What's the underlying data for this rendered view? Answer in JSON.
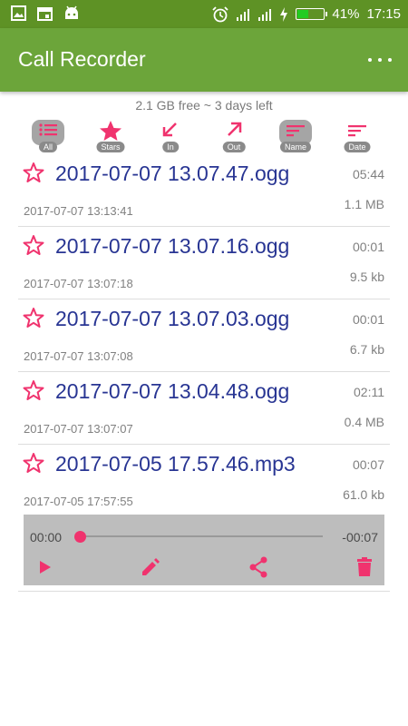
{
  "status_bar": {
    "battery_percent": "41%",
    "time": "17:15",
    "icons": [
      "gallery-icon",
      "calendar-icon",
      "android-icon",
      "alarm-icon",
      "signal-icon",
      "signal-icon",
      "charging-icon",
      "battery-icon"
    ]
  },
  "app_bar": {
    "title": "Call Recorder",
    "menu_icon": "more-options-icon"
  },
  "storage_text": "2.1 GB free ~ 3 days left",
  "filters": [
    {
      "label": "All",
      "icon": "list-icon",
      "selected": true
    },
    {
      "label": "Stars",
      "icon": "star-icon",
      "selected": false
    },
    {
      "label": "In",
      "icon": "incoming-arrow-icon",
      "selected": false
    },
    {
      "label": "Out",
      "icon": "outgoing-arrow-icon",
      "selected": false
    },
    {
      "label": "Name",
      "icon": "sort-name-icon",
      "selected": true
    },
    {
      "label": "Date",
      "icon": "sort-date-icon",
      "selected": false
    }
  ],
  "recordings": [
    {
      "filename": "2017-07-07 13.07.47.ogg",
      "duration": "05:44",
      "date": "2017-07-07 13:13:41",
      "size": "1.1 MB"
    },
    {
      "filename": "2017-07-07 13.07.16.ogg",
      "duration": "00:01",
      "date": "2017-07-07 13:07:18",
      "size": "9.5 kb"
    },
    {
      "filename": "2017-07-07 13.07.03.ogg",
      "duration": "00:01",
      "date": "2017-07-07 13:07:08",
      "size": "6.7 kb"
    },
    {
      "filename": "2017-07-07 13.04.48.ogg",
      "duration": "02:11",
      "date": "2017-07-07 13:07:07",
      "size": "0.4 MB"
    },
    {
      "filename": "2017-07-05 17.57.46.mp3",
      "duration": "00:07",
      "date": "2017-07-05 17:57:55",
      "size": "61.0 kb"
    }
  ],
  "player": {
    "elapsed": "00:00",
    "remaining": "-00:07",
    "progress": 0.0,
    "buttons": [
      "play-icon",
      "edit-icon",
      "share-icon",
      "delete-icon"
    ]
  },
  "colors": {
    "status_bar": "#5e9225",
    "app_bar": "#6ca53a",
    "accent": "#f0336e",
    "filename": "#283593"
  }
}
